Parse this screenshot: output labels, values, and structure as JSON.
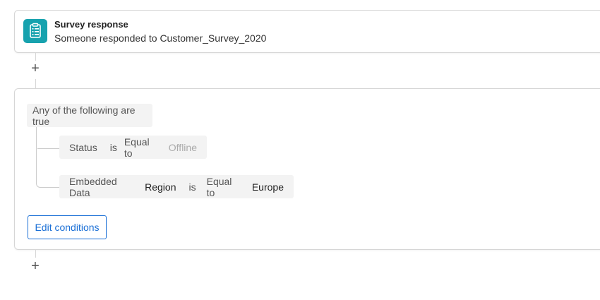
{
  "trigger": {
    "icon": "clipboard-list-icon",
    "icon_color": "#17a2ae",
    "title": "Survey response",
    "subtitle": "Someone responded to Customer_Survey_2020"
  },
  "add_step_label": "+",
  "condition": {
    "group_label": "Any of the following are true",
    "rows": [
      {
        "field": "Status",
        "operator_is": "is",
        "operator": "Equal to",
        "value": "Offline"
      },
      {
        "source": "Embedded Data",
        "field": "Region",
        "operator_is": "is",
        "operator": "Equal to",
        "value": "Europe"
      }
    ],
    "edit_button": "Edit conditions",
    "accent": "#1a6fd6"
  }
}
